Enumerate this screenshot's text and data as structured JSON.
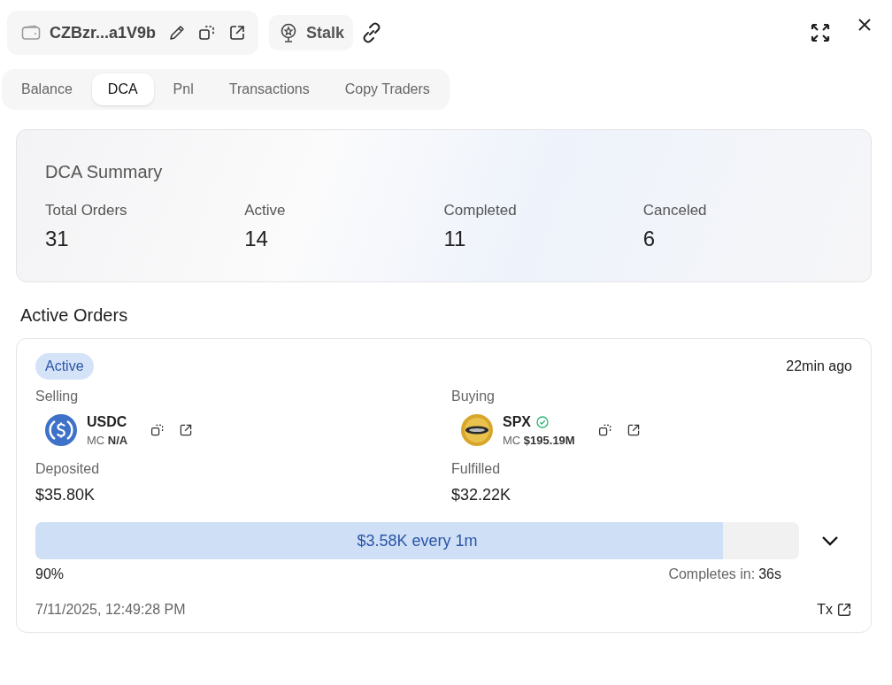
{
  "wallet": {
    "address": "CZBzr...a1V9b"
  },
  "stalk": {
    "label": "Stalk"
  },
  "tabs": [
    {
      "label": "Balance",
      "selected": false
    },
    {
      "label": "DCA",
      "selected": true
    },
    {
      "label": "Pnl",
      "selected": false
    },
    {
      "label": "Transactions",
      "selected": false
    },
    {
      "label": "Copy Traders",
      "selected": false
    }
  ],
  "summary": {
    "title": "DCA Summary",
    "stats": [
      {
        "label": "Total Orders",
        "value": "31"
      },
      {
        "label": "Active",
        "value": "14"
      },
      {
        "label": "Completed",
        "value": "11"
      },
      {
        "label": "Canceled",
        "value": "6"
      }
    ]
  },
  "active_orders": {
    "heading": "Active Orders",
    "orders": [
      {
        "status": "Active",
        "time_ago": "22min ago",
        "sides": [
          {
            "label": "Selling",
            "token": "USDC",
            "kind": "usdc",
            "verified": false,
            "mc": "MC **N/A**",
            "amount_label": "Deposited",
            "amount": "$35.80K"
          },
          {
            "label": "Buying",
            "token": "SPX",
            "kind": "spx",
            "verified": true,
            "mc": "MC **$195.19M**",
            "amount_label": "Fulfilled",
            "amount": "$32.22K"
          }
        ],
        "progress": {
          "label": "$3.58K every 1m",
          "level": 0.9,
          "percent": "90%",
          "completes_label": "Completes in:",
          "completes_value": "36s"
        },
        "timestamp": "7/11/2025, 12:49:28 PM",
        "tx_label": "Tx"
      }
    ]
  }
}
